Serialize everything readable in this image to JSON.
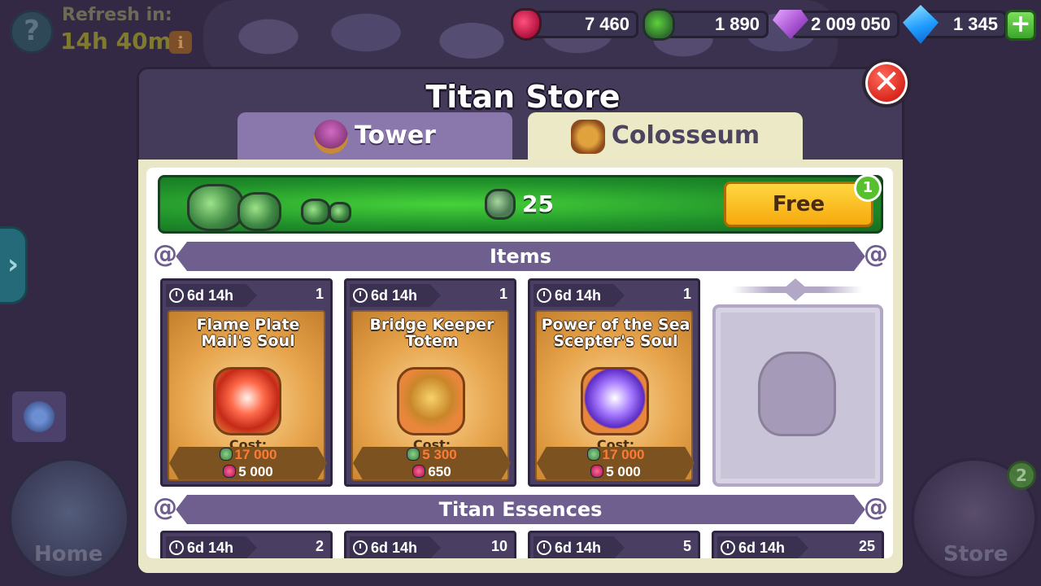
{
  "top_left": {
    "refresh_label": "Refresh in:",
    "refresh_time": "14h 40m",
    "help_icon": "?",
    "info_icon": "i"
  },
  "currencies": [
    {
      "name": "titan-potion-icon",
      "value": "7 460"
    },
    {
      "name": "titan-soul-stone-icon",
      "value": "1 890"
    },
    {
      "name": "gem-icon",
      "value": "2 009 050"
    },
    {
      "name": "diamond-icon",
      "value": "1 345"
    }
  ],
  "add_label": "+",
  "modal": {
    "title": "Titan Store",
    "close_label": "✕",
    "tabs": [
      {
        "label": "Tower",
        "active": false
      },
      {
        "label": "Colosseum",
        "active": true
      }
    ]
  },
  "free_offer": {
    "amount": "25",
    "button_label": "Free",
    "badge": "1"
  },
  "sections": {
    "items": "Items",
    "essences": "Titan Essences"
  },
  "items": [
    {
      "timer": "6d 14h",
      "qty": "1",
      "name_line1": "Flame Plate",
      "name_line2": "Mail's Soul",
      "cost_label": "Cost:",
      "cost_primary": "17 000",
      "cost_secondary": "5 000"
    },
    {
      "timer": "6d 14h",
      "qty": "1",
      "name_line1": "Bridge Keeper",
      "name_line2": "Totem",
      "cost_label": "Cost:",
      "cost_primary": "5 300",
      "cost_secondary": "650"
    },
    {
      "timer": "6d 14h",
      "qty": "1",
      "name_line1": "Power of the Sea",
      "name_line2": "Scepter's Soul",
      "cost_label": "Cost:",
      "cost_primary": "17 000",
      "cost_secondary": "5 000"
    }
  ],
  "essences": [
    {
      "timer": "6d 14h",
      "qty": "2"
    },
    {
      "timer": "6d 14h",
      "qty": "10"
    },
    {
      "timer": "6d 14h",
      "qty": "5"
    },
    {
      "timer": "6d 14h",
      "qty": "25"
    }
  ],
  "bottom_nav": {
    "home_label": "Home",
    "store_label": "Store",
    "store_badge": "2",
    "side_arrow": "›"
  },
  "colors": {
    "accent_green": "#46d23a",
    "free_button": "#ffd740",
    "section_header": "#6f5f8f",
    "close_red": "#d8261d",
    "cost_orange": "#ff7a35"
  }
}
